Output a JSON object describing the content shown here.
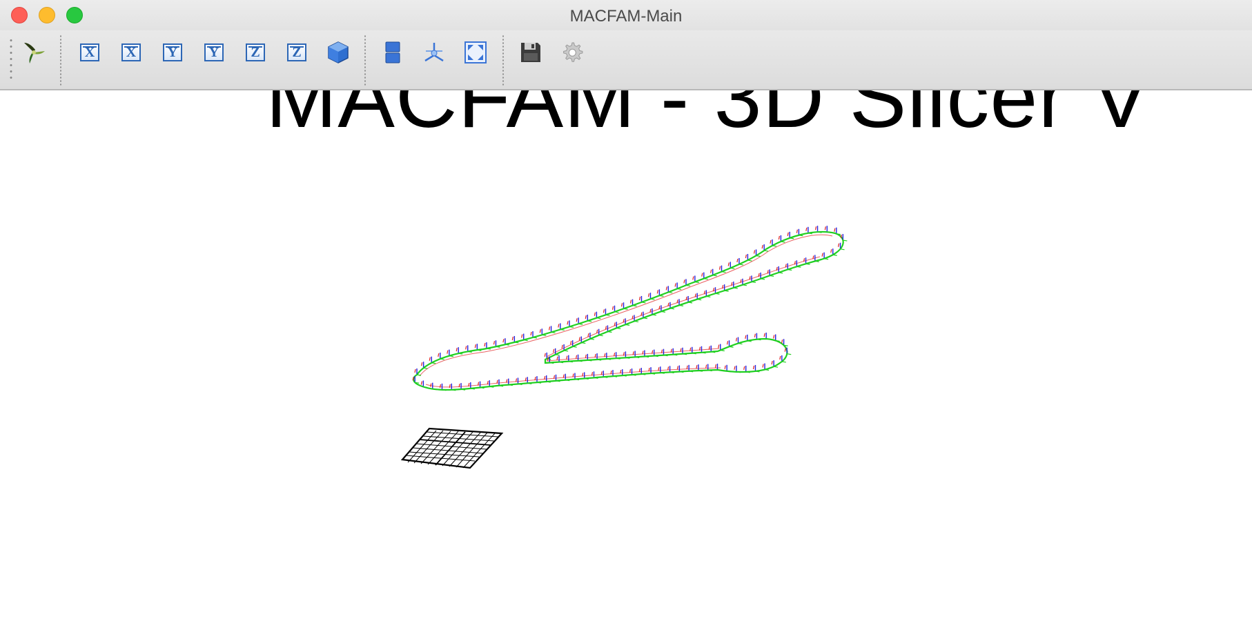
{
  "window": {
    "title": "MACFAM-Main"
  },
  "toolbar": {
    "view_buttons": [
      {
        "label": "X",
        "name": "view-x-positive-button"
      },
      {
        "label": "X",
        "name": "view-x-negative-button"
      },
      {
        "label": "Y",
        "name": "view-y-positive-button"
      },
      {
        "label": "Y",
        "name": "view-y-negative-button"
      },
      {
        "label": "Z",
        "name": "view-z-positive-button"
      },
      {
        "label": "Z",
        "name": "view-z-negative-button"
      }
    ],
    "icons": {
      "logo": "tri-blade-logo-icon",
      "iso": "iso-cube-icon",
      "layers": "layer-stack-icon",
      "axes": "axes-reset-icon",
      "fit": "fit-view-icon",
      "save": "save-disk-icon",
      "settings": "gear-icon"
    }
  },
  "viewport": {
    "overlay_text": "MACFAM - 3D Slicer V"
  },
  "colors": {
    "toolpath": "#1fcf1f",
    "normals_red": "#e02020",
    "normals_blue": "#2020e0",
    "grid": "#000000",
    "accent": "#2c66b5"
  }
}
